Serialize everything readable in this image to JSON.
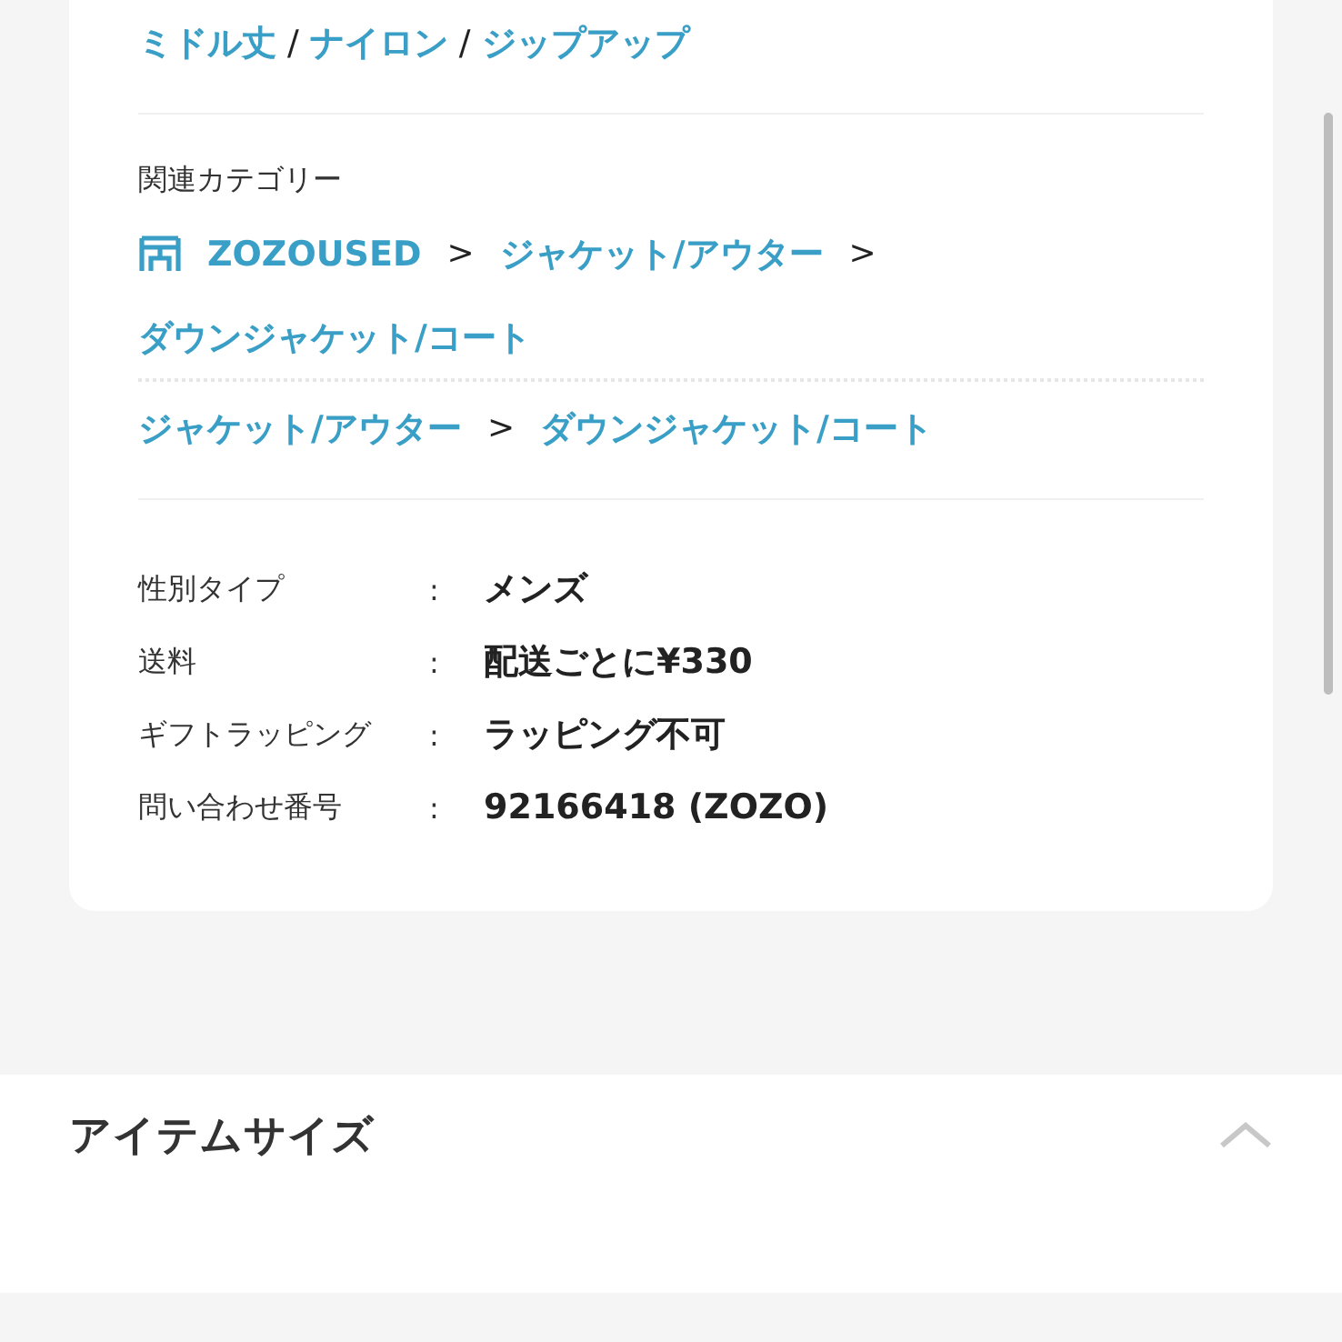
{
  "tags": {
    "items": [
      "ミドル丈",
      "ナイロン",
      "ジップアップ"
    ],
    "separator": "/"
  },
  "related_categories": {
    "title": "関連カテゴリー",
    "separator": ">",
    "paths": [
      {
        "shop_icon": true,
        "items": [
          "ZOZOUSED",
          "ジャケット/アウター",
          "ダウンジャケット/コート"
        ]
      },
      {
        "shop_icon": false,
        "items": [
          "ジャケット/アウター",
          "ダウンジャケット/コート"
        ]
      }
    ]
  },
  "details": [
    {
      "label": "性別タイプ",
      "colon": ":",
      "value": "メンズ"
    },
    {
      "label": "送料",
      "colon": ":",
      "value": "配送ごとに¥330"
    },
    {
      "label": "ギフトラッピング",
      "colon": ":",
      "value": "ラッピング不可"
    },
    {
      "label": "問い合わせ番号",
      "colon": ":",
      "value": "92166418 (ZOZO)"
    }
  ],
  "item_size_section": {
    "title": "アイテムサイズ",
    "expanded": true
  }
}
